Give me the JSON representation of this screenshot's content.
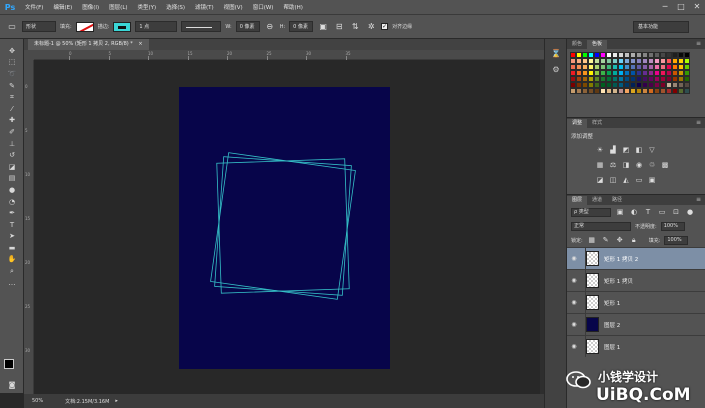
{
  "app": {
    "logo": "Ps"
  },
  "menu": [
    "文件(F)",
    "编辑(E)",
    "图像(I)",
    "图层(L)",
    "类型(Y)",
    "选择(S)",
    "滤镜(T)",
    "视图(V)",
    "窗口(W)",
    "帮助(H)"
  ],
  "window_controls": [
    "─",
    "□",
    "✕"
  ],
  "options": {
    "shape_mode": "形状",
    "fill_label": "填充:",
    "stroke_label": "描边:",
    "stroke_width": "1 点",
    "w_label": "W:",
    "w_value": "0 像素",
    "h_label": "H:",
    "h_value": "0 像素",
    "align_edges_label": "对齐边缘",
    "workspace": "基本功能",
    "fill_color": "none",
    "stroke_color": "#3ad6d6"
  },
  "document": {
    "tab_title": "未标题-1 @ 50% (矩形 1 拷贝 2, RGB/8) *",
    "close": "×",
    "ruler_h": [
      "0",
      "5",
      "10",
      "15",
      "20",
      "25",
      "30",
      "35"
    ],
    "ruler_v": [
      "0",
      "5",
      "10",
      "15",
      "20",
      "25",
      "30"
    ],
    "canvas_color": "#07054a",
    "shape_stroke": "#3ad6d6"
  },
  "status": {
    "zoom": "50%",
    "doc_info": "文档:2.15M/3.16M"
  },
  "panels": {
    "swatches_tabs": [
      "颜色",
      "色板"
    ],
    "adjustments_tabs": [
      "调整",
      "样式"
    ],
    "adjustments_title": "添加调整",
    "layers_tabs": [
      "图层",
      "通道",
      "路径"
    ],
    "layers_filter": "ρ 类型",
    "blend_mode": "正常",
    "opacity_label": "不透明度:",
    "opacity_value": "100%",
    "lock_label": "锁定:",
    "fill_label": "填充:",
    "fill_value": "100%"
  },
  "layers": [
    {
      "name": "矩形 1 拷贝 2",
      "selected": true,
      "thumb": "transparent"
    },
    {
      "name": "矩形 1 拷贝",
      "selected": false,
      "thumb": "transparent"
    },
    {
      "name": "矩形 1",
      "selected": false,
      "thumb": "transparent"
    },
    {
      "name": "图层 2",
      "selected": false,
      "thumb": "navy"
    },
    {
      "name": "图层 1",
      "selected": false,
      "thumb": "transparent"
    }
  ],
  "watermark": {
    "line1": "小钱学设计",
    "line2": "UiBQ.CoM"
  }
}
